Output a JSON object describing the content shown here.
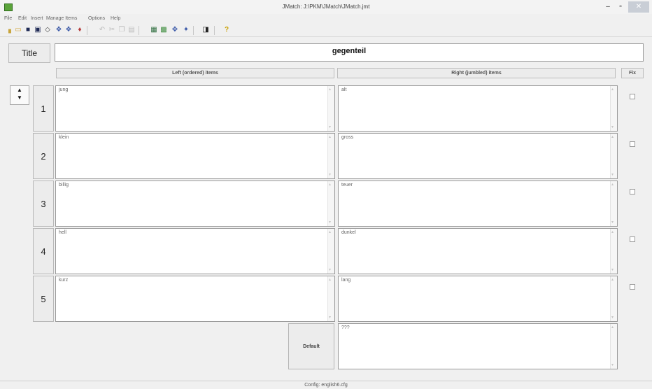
{
  "window": {
    "title": "JMatch: J:\\PKM\\JMatch\\JMatch.jmt",
    "minimize": "–",
    "maximize": "▫",
    "close": "✕"
  },
  "menu": [
    "File",
    "Edit",
    "Insert",
    "Manage Items",
    "Options",
    "Help"
  ],
  "toolbar_icons": [
    "new-icon",
    "open-icon",
    "save-icon",
    "save-as-icon",
    "preview-icon",
    "web-page-icon",
    "web-page-alt-icon",
    "exit-icon",
    "undo-icon",
    "cut-icon",
    "copy-icon",
    "paste-icon",
    "export-icon",
    "print-icon",
    "settings-icon",
    "config-icon",
    "book-icon",
    "help-icon"
  ],
  "title_label": "Title",
  "title_value": "gegenteil",
  "headers": {
    "left": "Left (ordered) items",
    "right": "Right (jumbled) items",
    "fix": "Fix"
  },
  "spinner": {
    "up": "▲",
    "down": "▼"
  },
  "rows": [
    {
      "num": "1",
      "left": "jung",
      "right": "alt"
    },
    {
      "num": "2",
      "left": "klein",
      "right": "gross"
    },
    {
      "num": "3",
      "left": "billig",
      "right": "teuer"
    },
    {
      "num": "4",
      "left": "hell",
      "right": "dunkel"
    },
    {
      "num": "5",
      "left": "kurz",
      "right": "lang"
    }
  ],
  "default_button": "Default",
  "default_value": "???",
  "status": "Config: english6.cfg"
}
